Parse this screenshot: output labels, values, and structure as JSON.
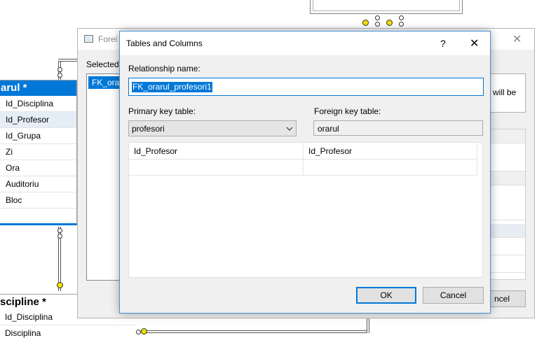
{
  "diagram": {
    "orarul_table": {
      "title": "arul *",
      "columns": [
        "Id_Disciplina",
        "Id_Profesor",
        "Id_Grupa",
        "Zi",
        "Ora",
        "Auditoriu",
        "Bloc"
      ]
    },
    "discipline_table": {
      "title": "sciplinе *",
      "columns": [
        "Id_Disciplina",
        "Disciplina"
      ]
    }
  },
  "background_dialog": {
    "title": "Forei",
    "selected_label": "Selected",
    "selected_item": "FK_orar",
    "side_text": "will be",
    "cancel_label": "ncel",
    "close_glyph": "✕"
  },
  "dialog": {
    "title": "Tables and Columns",
    "help_glyph": "?",
    "close_glyph": "✕",
    "relationship_name_label": "Relationship name:",
    "relationship_name_value": "FK_orarul_profesori1",
    "primary_key_table_label": "Primary key table:",
    "primary_key_table_value": "profesori",
    "foreign_key_table_label": "Foreign key table:",
    "foreign_key_table_value": "orarul",
    "column_mappings": [
      {
        "primary": "Id_Profesor",
        "foreign": "Id_Profesor"
      },
      {
        "primary": "",
        "foreign": ""
      }
    ],
    "ok_label": "OK",
    "cancel_label": "Cancel"
  }
}
